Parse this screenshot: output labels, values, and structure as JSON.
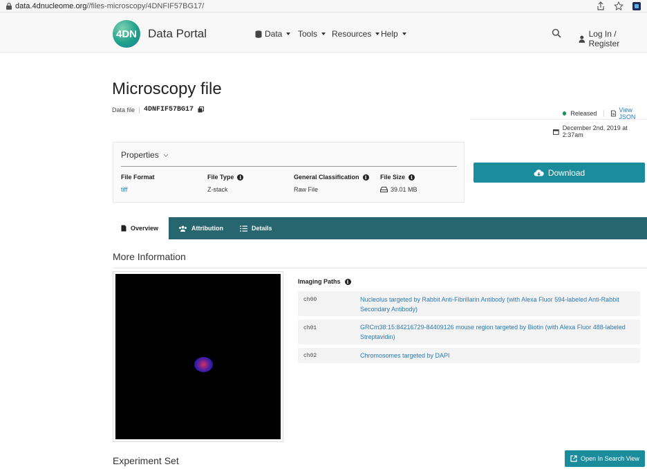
{
  "browser": {
    "url_host": "data.4dnucleome.org",
    "url_path": "//files-microscopy/4DNFIF57BG17/"
  },
  "nav": {
    "logo_text": "4DN",
    "brand": "Data Portal",
    "menus": [
      "Data",
      "Tools",
      "Resources",
      "Help"
    ],
    "login": "Log In / Register"
  },
  "header": {
    "title": "Microscopy file",
    "type_label": "Data file",
    "accession": "4DNFIF57BG17",
    "status": "Released",
    "view_json": "View JSON",
    "date": "December 2nd, 2019 at 2:37am"
  },
  "properties": {
    "title": "Properties",
    "fields": [
      {
        "label": "File Format",
        "value": "tiff"
      },
      {
        "label": "File Type",
        "value": "Z-stack"
      },
      {
        "label": "General Classification",
        "value": "Raw File"
      },
      {
        "label": "File Size",
        "value": "39.01 MB"
      }
    ]
  },
  "download": {
    "label": "Download"
  },
  "tabs": [
    "Overview",
    "Attribution",
    "Details"
  ],
  "more_info": {
    "title": "More Information",
    "imaging_paths_label": "Imaging Paths",
    "paths": [
      {
        "channel": "ch00",
        "desc": "Nucleolus targeted by Rabbit Anti-Fibrillarin Antibody (with Alexa Fluor 594-labeled Anti-Rabbit Secondary Antibody)"
      },
      {
        "channel": "ch01",
        "desc": "GRCm38:15:84216729-84409126 mouse region targeted by Biotin (with Alexa Fluor 488-labeled Streptavidin)"
      },
      {
        "channel": "ch02",
        "desc": "Chromosomes targeted by DAPI"
      }
    ]
  },
  "experiment_set": {
    "title": "Experiment Set",
    "open_search": "Open In Search View"
  }
}
